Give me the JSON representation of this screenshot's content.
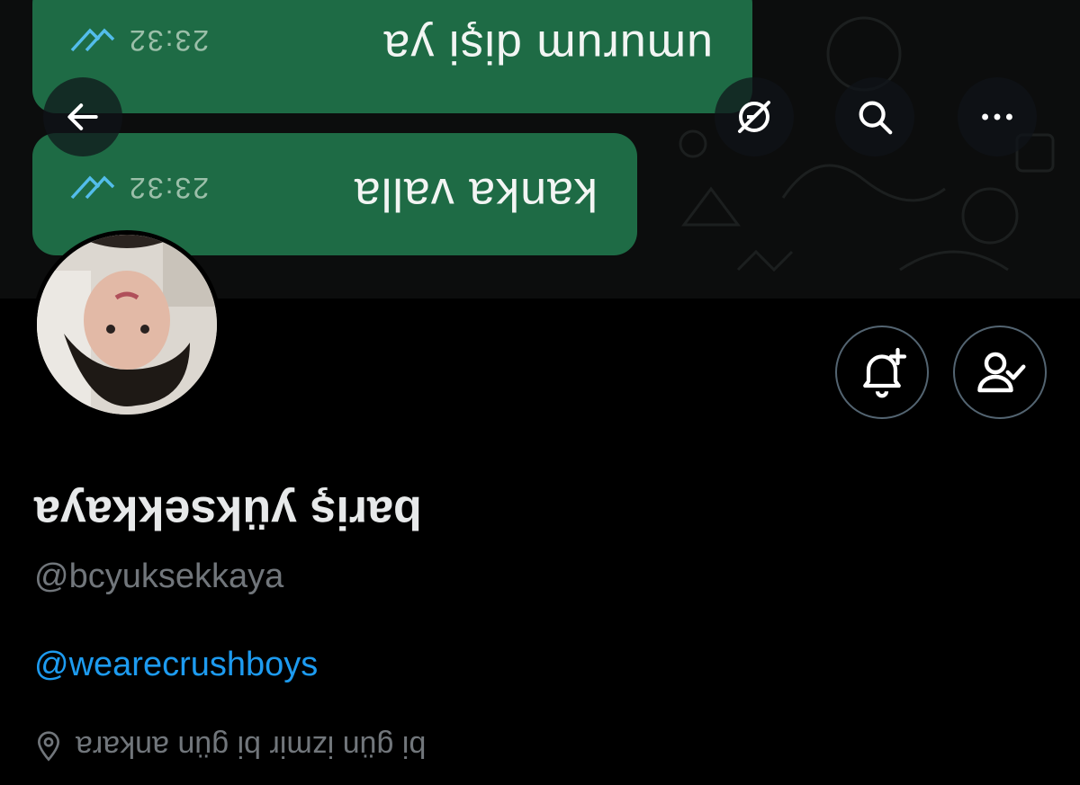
{
  "banner": {
    "messages": [
      {
        "text": "umurum dişi ya",
        "time": "23:32"
      },
      {
        "text": "kanka valla",
        "time": "23:32"
      }
    ]
  },
  "nav": {
    "back_icon": "arrow-left-icon",
    "translate_icon": "translate-icon",
    "search_icon": "search-icon",
    "more_icon": "more-horizontal-icon"
  },
  "profile": {
    "display_name": "bariş yüksekkaya",
    "handle": "@bcyuksekkaya",
    "bio_link": "@wearecrushboys",
    "location": "bi gün izmir bi gün ankara"
  },
  "actions": {
    "notify_icon": "bell-plus-icon",
    "following_icon": "person-check-icon"
  },
  "colors": {
    "background": "#000000",
    "bubble": "#1e6b45",
    "link": "#1d9bf0",
    "muted": "#71767b"
  }
}
